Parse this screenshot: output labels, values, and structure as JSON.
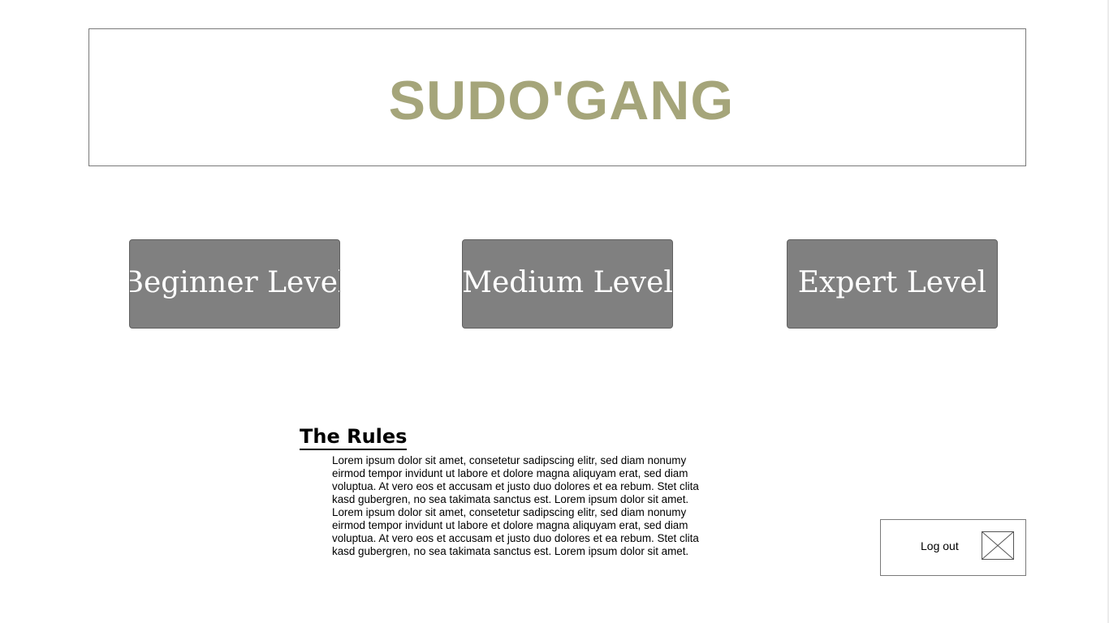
{
  "header": {
    "title": "SUDO'GANG"
  },
  "levels": [
    {
      "label": "Beginner Level"
    },
    {
      "label": "Medium Level"
    },
    {
      "label": "Expert Level"
    }
  ],
  "rules": {
    "title": "The Rules",
    "body": "Lorem ipsum dolor sit amet, consetetur sadipscing elitr, sed diam nonumy\neirmod tempor invidunt ut labore et dolore magna aliquyam erat, sed diam\nvoluptua. At vero eos et accusam et justo duo dolores et ea rebum. Stet clita\nkasd gubergren, no sea takimata sanctus est. Lorem ipsum dolor sit amet.\nLorem ipsum dolor sit amet, consetetur sadipscing elitr, sed diam nonumy\neirmod tempor invidunt ut labore et dolore magna aliquyam erat, sed diam\nvoluptua. At vero eos et accusam et justo duo dolores et ea rebum. Stet clita\nkasd gubergren, no sea takimata sanctus est. Lorem ipsum dolor sit amet."
  },
  "logout": {
    "label": "Log out",
    "icon": "image-placeholder-icon"
  },
  "colors": {
    "title": "#a5a57a",
    "button_bg": "#808080",
    "button_text": "#ffffff"
  }
}
